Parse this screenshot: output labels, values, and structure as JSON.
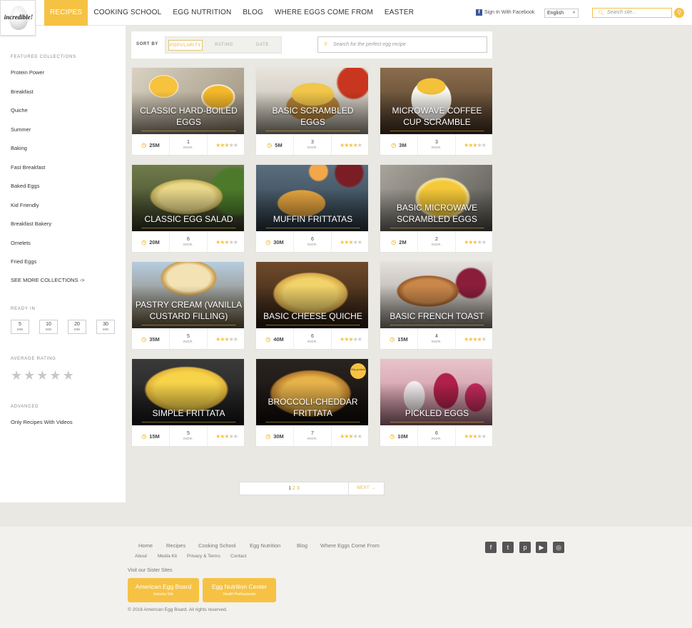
{
  "header": {
    "logo_text": "incredible!",
    "nav": [
      "RECIPES",
      "COOKING SCHOOL",
      "EGG NUTRITION",
      "BLOG",
      "WHERE EGGS COME FROM",
      "EASTER"
    ],
    "facebook": "Sign In With Facebook",
    "language": "English",
    "site_search_placeholder": "Search site..."
  },
  "sidebar": {
    "featured_heading": "FEATURED COLLECTIONS",
    "collections": [
      "Protein Power",
      "Breakfast",
      "Quiche",
      "Summer",
      "Baking",
      "Fast Breakfast",
      "Baked Eggs",
      "Kid Friendly",
      "Breakfast Bakery",
      "Omelets",
      "Fried Eggs"
    ],
    "see_more": "SEE MORE COLLECTIONS ->",
    "ready_heading": "READY IN",
    "ready_in": [
      "5",
      "10",
      "20",
      "30"
    ],
    "min_label": "MIN",
    "rating_heading": "AVERAGE RATING",
    "advanced_heading": "ADVANCED",
    "videos_only": "Only Recipes With Videos"
  },
  "sort": {
    "label": "SORT BY",
    "options": [
      "POPULARITY",
      "RATING",
      "DATE"
    ],
    "active": "POPULARITY",
    "search_placeholder": "Search for the perfect egg recipe"
  },
  "ingr_label": "INGR.",
  "recipes": [
    {
      "title": "CLASSIC HARD-BOILED EGGS",
      "time": "25M",
      "ingr": "1",
      "rating": 3
    },
    {
      "title": "BASIC SCRAMBLED EGGS",
      "time": "5M",
      "ingr": "3",
      "rating": 3.5
    },
    {
      "title": "MICROWAVE COFFEE CUP SCRAMBLE",
      "time": "3M",
      "ingr": "3",
      "rating": 3
    },
    {
      "title": "CLASSIC EGG SALAD",
      "time": "20M",
      "ingr": "6",
      "rating": 3
    },
    {
      "title": "MUFFIN FRITTATAS",
      "time": "30M",
      "ingr": "6",
      "rating": 2.5
    },
    {
      "title": "BASIC MICROWAVE SCRAMBLED EGGS",
      "time": "2M",
      "ingr": "2",
      "rating": 3
    },
    {
      "title": "PASTRY CREAM (VANILLA CUSTARD FILLING)",
      "time": "35M",
      "ingr": "5",
      "rating": 3
    },
    {
      "title": "BASIC CHEESE QUICHE",
      "time": "40M",
      "ingr": "6",
      "rating": 3
    },
    {
      "title": "BASIC FRENCH TOAST",
      "time": "15M",
      "ingr": "4",
      "rating": 3.5
    },
    {
      "title": "SIMPLE FRITTATA",
      "time": "15M",
      "ingr": "5",
      "rating": 3
    },
    {
      "title": "BROCCOLI-CHEDDAR FRITTATA",
      "time": "30M",
      "ingr": "7",
      "rating": 2.5,
      "badge": "30g protein"
    },
    {
      "title": "PICKLED EGGS",
      "time": "10M",
      "ingr": "6",
      "rating": 3
    }
  ],
  "pagination": {
    "current": "1",
    "pages": [
      "2",
      "3"
    ],
    "next": "NEXT →"
  },
  "footer": {
    "nav": [
      "Home",
      "Recipes",
      "Cooking School",
      "Egg Nutrition",
      "Blog",
      "Where Eggs Come From"
    ],
    "sub": [
      "About",
      "Media Kit",
      "Privacy & Terms",
      "Contact"
    ],
    "sister_label": "Visit our Sister Sites",
    "sister_sites": [
      {
        "name": "American Egg Board",
        "sub": "Industry Site"
      },
      {
        "name": "Egg Nutrition Center",
        "sub": "Health Professionals"
      }
    ],
    "social": [
      "facebook-icon",
      "twitter-icon",
      "pinterest-icon",
      "youtube-icon",
      "instagram-icon"
    ],
    "copyright": "© 2016 American Egg Board. All rights reserved."
  },
  "colors": {
    "accent": "#f6c244",
    "page_bg": "#e9e8e3"
  }
}
